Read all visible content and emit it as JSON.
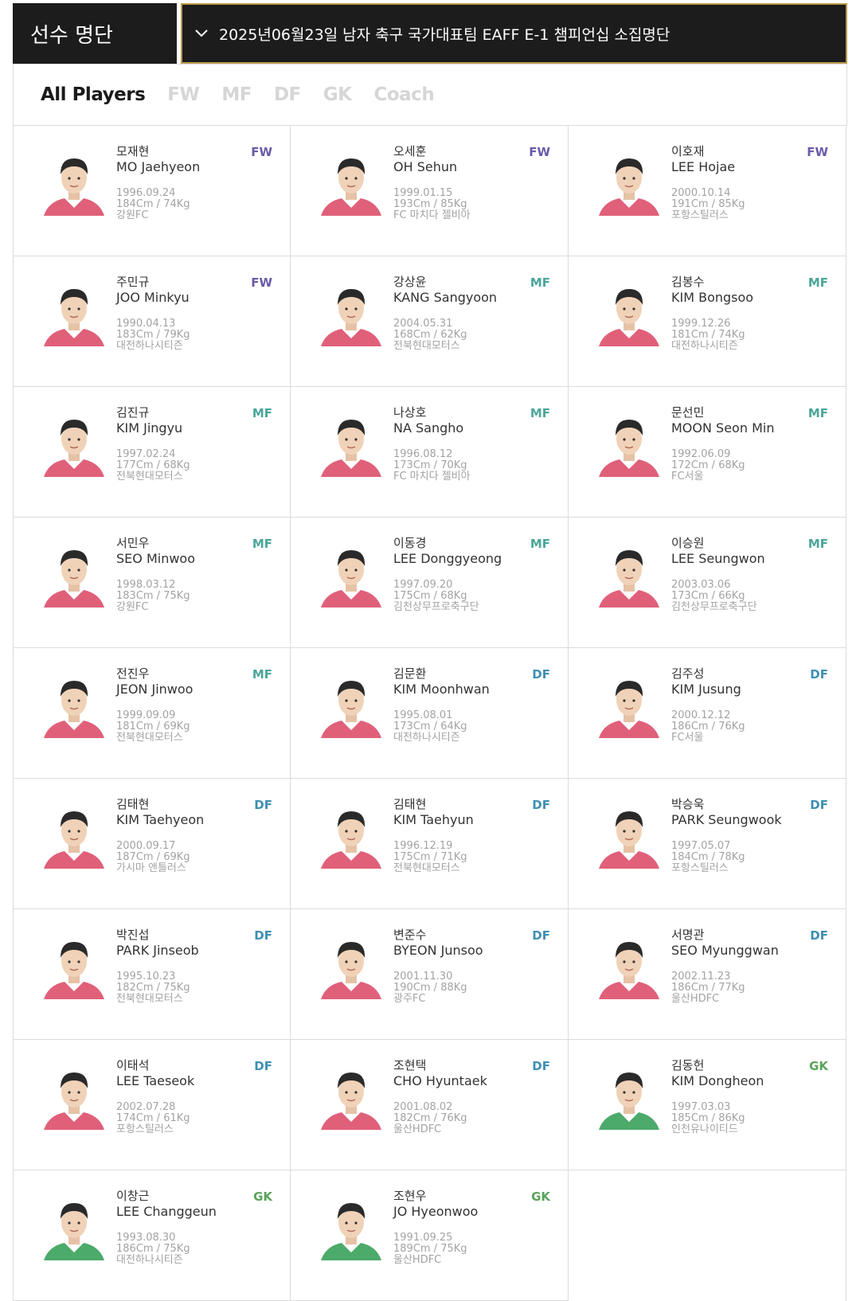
{
  "header": {
    "title": "선수 명단",
    "selected_squad": "2025년06월23일 남자 축구 국가대표팀 EAFF E-1 챔피언십 소집명단"
  },
  "tabs": [
    {
      "label": "All Players",
      "active": true
    },
    {
      "label": "FW",
      "active": false
    },
    {
      "label": "MF",
      "active": false
    },
    {
      "label": "DF",
      "active": false
    },
    {
      "label": "GK",
      "active": false
    },
    {
      "label": "Coach",
      "active": false
    }
  ],
  "colors": {
    "FW": "#6b5aa8",
    "MF": "#4aa69a",
    "DF": "#3f8fb3",
    "GK": "#5aa35a",
    "jersey_field": "#e0607a",
    "jersey_gk": "#4caa6a"
  },
  "players": [
    {
      "name_ko": "모재현",
      "name_en": "MO Jaehyeon",
      "pos": "FW",
      "birth": "1996.09.24",
      "body": "184Cm / 74Kg",
      "club": "강원FC"
    },
    {
      "name_ko": "오세훈",
      "name_en": "OH Sehun",
      "pos": "FW",
      "birth": "1999.01.15",
      "body": "193Cm / 85Kg",
      "club": "FC 마치다 젤비아"
    },
    {
      "name_ko": "이호재",
      "name_en": "LEE Hojae",
      "pos": "FW",
      "birth": "2000.10.14",
      "body": "191Cm / 85Kg",
      "club": "포항스틸러스"
    },
    {
      "name_ko": "주민규",
      "name_en": "JOO Minkyu",
      "pos": "FW",
      "birth": "1990.04.13",
      "body": "183Cm / 79Kg",
      "club": "대전하나시티즌"
    },
    {
      "name_ko": "강상윤",
      "name_en": "KANG Sangyoon",
      "pos": "MF",
      "birth": "2004.05.31",
      "body": "168Cm / 62Kg",
      "club": "전북현대모터스"
    },
    {
      "name_ko": "김봉수",
      "name_en": "KIM Bongsoo",
      "pos": "MF",
      "birth": "1999.12.26",
      "body": "181Cm / 74Kg",
      "club": "대전하나시티즌"
    },
    {
      "name_ko": "김진규",
      "name_en": "KIM Jingyu",
      "pos": "MF",
      "birth": "1997.02.24",
      "body": "177Cm / 68Kg",
      "club": "전북현대모터스"
    },
    {
      "name_ko": "나상호",
      "name_en": "NA Sangho",
      "pos": "MF",
      "birth": "1996.08.12",
      "body": "173Cm / 70Kg",
      "club": "FC 마치다 젤비아"
    },
    {
      "name_ko": "문선민",
      "name_en": "MOON Seon Min",
      "pos": "MF",
      "birth": "1992.06.09",
      "body": "172Cm / 68Kg",
      "club": "FC서울"
    },
    {
      "name_ko": "서민우",
      "name_en": "SEO Minwoo",
      "pos": "MF",
      "birth": "1998.03.12",
      "body": "183Cm / 75Kg",
      "club": "강원FC"
    },
    {
      "name_ko": "이동경",
      "name_en": "LEE Donggyeong",
      "pos": "MF",
      "birth": "1997.09.20",
      "body": "175Cm / 68Kg",
      "club": "김천상무프로축구단"
    },
    {
      "name_ko": "이승원",
      "name_en": "LEE Seungwon",
      "pos": "MF",
      "birth": "2003.03.06",
      "body": "173Cm / 66Kg",
      "club": "김천상무프로축구단"
    },
    {
      "name_ko": "전진우",
      "name_en": "JEON Jinwoo",
      "pos": "MF",
      "birth": "1999.09.09",
      "body": "181Cm / 69Kg",
      "club": "전북현대모터스"
    },
    {
      "name_ko": "김문환",
      "name_en": "KIM Moonhwan",
      "pos": "DF",
      "birth": "1995.08.01",
      "body": "173Cm / 64Kg",
      "club": "대전하나시티즌"
    },
    {
      "name_ko": "김주성",
      "name_en": "KIM Jusung",
      "pos": "DF",
      "birth": "2000.12.12",
      "body": "186Cm / 76Kg",
      "club": "FC서울"
    },
    {
      "name_ko": "김태현",
      "name_en": "KIM Taehyeon",
      "pos": "DF",
      "birth": "2000.09.17",
      "body": "187Cm / 69Kg",
      "club": "가시마 앤틀러스"
    },
    {
      "name_ko": "김태현",
      "name_en": "KIM Taehyun",
      "pos": "DF",
      "birth": "1996.12.19",
      "body": "175Cm / 71Kg",
      "club": "전북현대모터스"
    },
    {
      "name_ko": "박승욱",
      "name_en": "PARK Seungwook",
      "pos": "DF",
      "birth": "1997.05.07",
      "body": "184Cm / 78Kg",
      "club": "포항스틸러스"
    },
    {
      "name_ko": "박진섭",
      "name_en": "PARK Jinseob",
      "pos": "DF",
      "birth": "1995.10.23",
      "body": "182Cm / 75Kg",
      "club": "전북현대모터스"
    },
    {
      "name_ko": "변준수",
      "name_en": "BYEON Junsoo",
      "pos": "DF",
      "birth": "2001.11.30",
      "body": "190Cm / 88Kg",
      "club": "광주FC"
    },
    {
      "name_ko": "서명관",
      "name_en": "SEO Myunggwan",
      "pos": "DF",
      "birth": "2002.11.23",
      "body": "186Cm / 77Kg",
      "club": "울산HDFC"
    },
    {
      "name_ko": "이태석",
      "name_en": "LEE Taeseok",
      "pos": "DF",
      "birth": "2002.07.28",
      "body": "174Cm / 61Kg",
      "club": "포항스틸러스"
    },
    {
      "name_ko": "조현택",
      "name_en": "CHO Hyuntaek",
      "pos": "DF",
      "birth": "2001.08.02",
      "body": "182Cm / 76Kg",
      "club": "울산HDFC"
    },
    {
      "name_ko": "김동헌",
      "name_en": "KIM Dongheon",
      "pos": "GK",
      "birth": "1997.03.03",
      "body": "185Cm / 86Kg",
      "club": "인천유나이티드"
    },
    {
      "name_ko": "이창근",
      "name_en": "LEE Changgeun",
      "pos": "GK",
      "birth": "1993.08.30",
      "body": "186Cm / 75Kg",
      "club": "대전하나시티즌"
    },
    {
      "name_ko": "조현우",
      "name_en": "JO Hyeonwoo",
      "pos": "GK",
      "birth": "1991.09.25",
      "body": "189Cm / 75Kg",
      "club": "울산HDFC"
    }
  ]
}
